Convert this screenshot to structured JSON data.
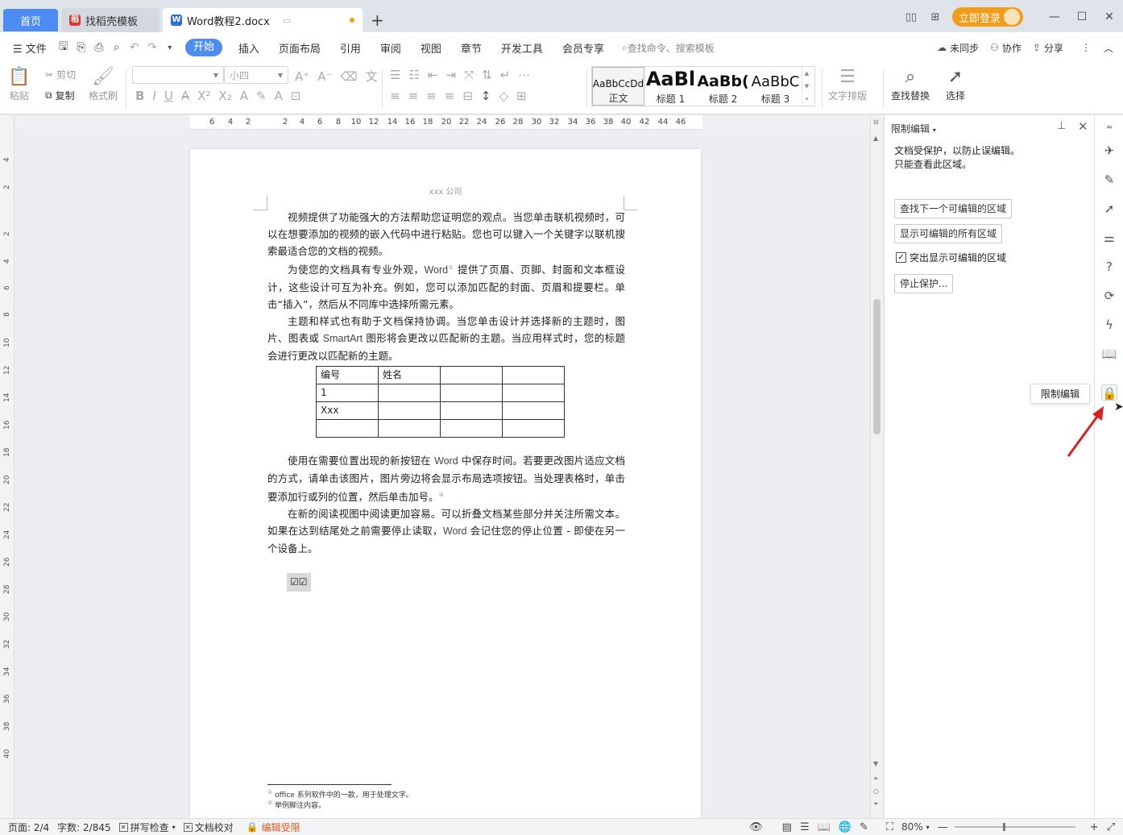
{
  "tabs": {
    "home": "首页",
    "templates": "找稻壳模板",
    "document": "Word教程2.docx"
  },
  "titlebar": {
    "login": "立即登录"
  },
  "menu": {
    "file": "文件",
    "items": [
      "开始",
      "插入",
      "页面布局",
      "引用",
      "审阅",
      "视图",
      "章节",
      "开发工具",
      "会员专享"
    ],
    "search_placeholder": "查找命令、搜索模板",
    "sync": "未同步",
    "collab": "协作",
    "share": "分享"
  },
  "ribbon": {
    "paste": "粘贴",
    "cut": "剪切",
    "copy": "复制",
    "format_painter": "格式刷",
    "font_name": "",
    "font_size": "小四",
    "styles": [
      {
        "sample": "AaBbCcDd",
        "name": "正文"
      },
      {
        "sample": "AaBl",
        "name": "标题 1"
      },
      {
        "sample": "AaBb(",
        "name": "标题 2"
      },
      {
        "sample": "AaBbC",
        "name": "标题 3"
      }
    ],
    "text_layout": "文字排版",
    "find_replace": "查找替换",
    "select": "选择"
  },
  "ruler": {
    "h_numbers": [
      "6",
      "4",
      "2",
      "2",
      "4",
      "6",
      "8",
      "10",
      "12",
      "14",
      "16",
      "18",
      "20",
      "22",
      "24",
      "26",
      "28",
      "30",
      "32",
      "34",
      "36",
      "38",
      "40",
      "42",
      "44",
      "46"
    ],
    "v_numbers": [
      "4",
      "2",
      "2",
      "4",
      "6",
      "8",
      "10",
      "12",
      "14",
      "16",
      "18",
      "20",
      "22",
      "24",
      "26",
      "28",
      "30",
      "32",
      "34",
      "36",
      "38",
      "40"
    ]
  },
  "document": {
    "header": "xxx 公司",
    "p1": "视频提供了功能强大的方法帮助您证明您的观点。当您单击联机视频时，可以在想要添加的视频的嵌入代码中进行粘贴。您也可以键入一个关键字以联机搜索最适合您的文档的视频。",
    "p2a": "为使您的文档具有专业外观，",
    "p2word": "Word",
    "p2b": " 提供了页眉、页脚、封面和文本框设计，这些设计可互为补充。例如，您可以添加匹配的封面、页眉和提要栏。单击“插入”，然后从不同库中选择所需元素。",
    "p3a": "主题和样式也有助于文档保持协调。当您单击设计并选择新的主题时，图片、图表或 ",
    "p3smart": "SmartArt",
    "p3b": " 图形将会更改以匹配新的主题。当应用样式时，您的标题会进行更改以匹配新的主题。",
    "table": [
      [
        "编号",
        "姓名",
        "",
        ""
      ],
      [
        "1",
        "",
        "",
        ""
      ],
      [
        "Xxx",
        "",
        "",
        ""
      ],
      [
        "",
        "",
        "",
        ""
      ]
    ],
    "p4a": "使用在需要位置出现的新按钮在 ",
    "p4word": "Word",
    "p4b": " 中保存时间。若要更改图片适应文档的方式，请单击该图片，图片旁边将会显示布局选项按钮。当处理表格时，单击要添加行或列的位置，然后单击加号。",
    "p5a": "在新的阅读视图中阅读更加容易。可以折叠文档某些部分并关注所需文本。如果在达到结尾处之前需要停止读取，",
    "p5word": "Word",
    "p5b": " 会记住您的停止位置 - 即使在另一个设备上。",
    "checkboxes": "☑☑",
    "footnote1": "office 系列软件中的一款，用于处理文字。",
    "footnote2": "举例脚注内容。"
  },
  "panel": {
    "title": "限制编辑",
    "desc1": "文档受保护，以防止误编辑。",
    "desc2": "只能查看此区域。",
    "find_next": "查找下一个可编辑的区域",
    "show_all": "显示可编辑的所有区域",
    "highlight": "突出显示可编辑的区域",
    "stop_protect": "停止保护..."
  },
  "tooltip": "限制编辑",
  "status": {
    "page": "页面: 2/4",
    "words": "字数: 2/845",
    "spell": "拼写检查",
    "proof": "文档校对",
    "restricted": "编辑受限",
    "zoom": "80%"
  },
  "colors": {
    "accent": "#4d8cf5",
    "login": "#f29d1a",
    "restricted": "#e8571d",
    "arrow": "#d92121"
  }
}
